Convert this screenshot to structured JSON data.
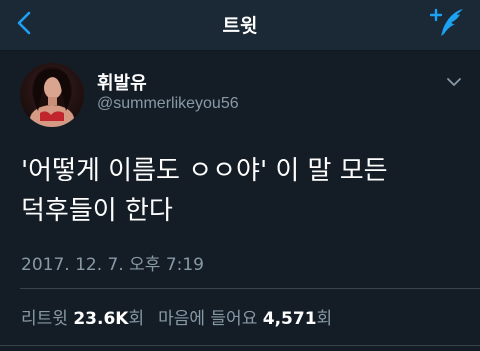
{
  "nav": {
    "title": "트윗",
    "back_icon": "chevron-left-icon",
    "compose_icon": "compose-tweet-icon",
    "accent_color": "#1da1f2"
  },
  "author": {
    "display_name": "휘발유",
    "username": "@summerlikeyou56"
  },
  "tweet": {
    "text": "'어떻게 이름도 ㅇㅇ야' 이 말 모든\n덕후들이 한다",
    "timestamp": "2017. 12. 7. 오후 7:19"
  },
  "stats": {
    "retweets_label": "리트윗",
    "retweets_count": "23.6K",
    "retweets_suffix": "회",
    "likes_label": "마음에 들어요",
    "likes_count": "4,571",
    "likes_suffix": "회"
  },
  "theme": {
    "background": "#141d26",
    "navbar": "#1b2836",
    "secondary_text": "#8899a6"
  }
}
